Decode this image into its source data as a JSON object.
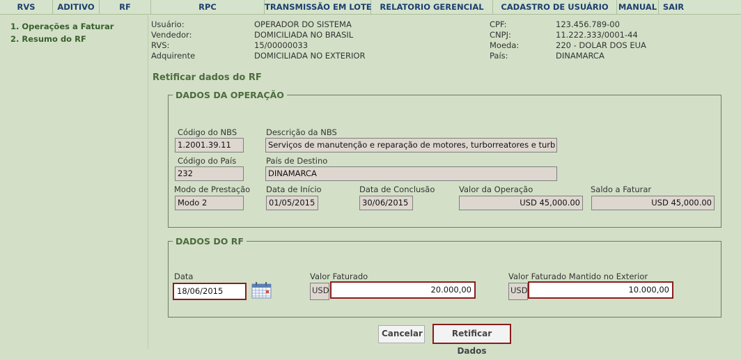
{
  "nav": {
    "items": [
      "RVS",
      "ADITIVO",
      "RF",
      "RPC",
      "TRANSMISSÃO EM LOTE",
      "RELATORIO GERENCIAL",
      "CADASTRO DE USUÁRIO",
      "MANUAL",
      "SAIR"
    ]
  },
  "sidebar": {
    "items": [
      "1.  Operações a Faturar",
      "2.  Resumo do RF"
    ]
  },
  "info": {
    "usuario_label": "Usuário:",
    "usuario": "OPERADOR DO SISTEMA",
    "vendedor_label": "Vendedor:",
    "vendedor": "DOMICILIADA NO BRASIL",
    "rvs_label": "RVS:",
    "rvs": "15/00000033",
    "adquirente_label": "Adquirente",
    "adquirente": "DOMICILIADA NO EXTERIOR",
    "cpf_label": "CPF:",
    "cpf": "123.456.789-00",
    "cnpj_label": "CNPJ:",
    "cnpj": "11.222.333/0001-44",
    "moeda_label": "Moeda:",
    "moeda": "220 - DOLAR DOS EUA",
    "pais_label": "País:",
    "pais": "DINAMARCA"
  },
  "page_title": "Retificar dados do RF",
  "operacao": {
    "legend": "DADOS DA OPERAÇÃO",
    "codigo_nbs_label": "Código do NBS",
    "codigo_nbs": "1.2001.39.11",
    "descricao_nbs_label": "Descrição da NBS",
    "descricao_nbs": "Serviços de manutenção e reparação de motores, turborreatores e turb",
    "codigo_pais_label": "Código do País",
    "codigo_pais": "232",
    "pais_destino_label": "País de Destino",
    "pais_destino": "DINAMARCA",
    "modo_label": "Modo de Prestação",
    "modo": "Modo 2",
    "data_inicio_label": "Data de Início",
    "data_inicio": "01/05/2015",
    "data_conclusao_label": "Data de Conclusão",
    "data_conclusao": "30/06/2015",
    "valor_operacao_label": "Valor da Operação",
    "valor_operacao": "USD 45,000.00",
    "saldo_label": "Saldo a Faturar",
    "saldo": "USD 45,000.00"
  },
  "rf": {
    "legend": "DADOS DO RF",
    "data_label": "Data",
    "data": "18/06/2015",
    "valor_faturado_label": "Valor Faturado",
    "valor_faturado_currency": "USD",
    "valor_faturado": "20.000,00",
    "valor_exterior_label": "Valor Faturado Mantido no Exterior",
    "valor_exterior_currency": "USD",
    "valor_exterior": "10.000,00"
  },
  "buttons": {
    "cancelar": "Cancelar",
    "retificar": "Retificar Dados"
  },
  "colors": {
    "highlight_border": "#8a1c1c",
    "nav_text": "#1c3f6e",
    "background": "#d3e0c7"
  }
}
